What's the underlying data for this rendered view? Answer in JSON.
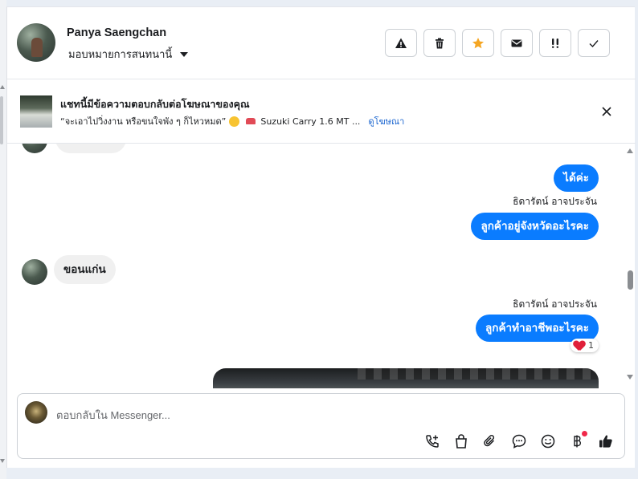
{
  "header": {
    "contact_name": "Panya Saengchan",
    "assign_label": "มอบหมายการสนทนานี้",
    "actions": [
      {
        "icon": "warning-icon"
      },
      {
        "icon": "trash-icon"
      },
      {
        "icon": "star-icon",
        "color": "#f5a623"
      },
      {
        "icon": "envelope-icon"
      },
      {
        "icon": "priority-icon"
      },
      {
        "icon": "check-icon"
      }
    ]
  },
  "ad_banner": {
    "title": "แชทนี้มีข้อความตอบกลับต่อโฆษณาของคุณ",
    "quote": "“จะเอาไปวิ่งงาน หรือขนใจพัง ๆ ก็ไหวหมด”",
    "product": "Suzuki Carry 1.6 MT ...",
    "link_label": "ดูโฆษณา",
    "link_color": "#1763cf"
  },
  "messages": [
    {
      "direction": "out",
      "text": "ได้ค่ะ"
    },
    {
      "direction": "out",
      "sender": "ธิดารัตน์ อาจประจัน",
      "text": "ลูกค้าอยู่จังหวัดอะไรคะ"
    },
    {
      "direction": "in",
      "text": "ขอนแก่น"
    },
    {
      "direction": "out",
      "sender": "ธิดารัตน์ อาจประจัน",
      "text": "ลูกค้าทำอาชีพอะไรคะ",
      "reaction": {
        "emoji": "heart",
        "count": "1"
      }
    }
  ],
  "composer": {
    "placeholder": "ตอบกลับใน Messenger...",
    "tools": [
      "call-add-icon",
      "shopping-bag-icon",
      "paperclip-icon",
      "chat-bubble-icon",
      "smiley-icon",
      "baht-icon",
      "thumbs-up-icon"
    ]
  },
  "colors": {
    "outgoing_bubble": "#0a7cff",
    "incoming_bubble": "#f0f0f0",
    "notification_dot": "#f0284a"
  }
}
